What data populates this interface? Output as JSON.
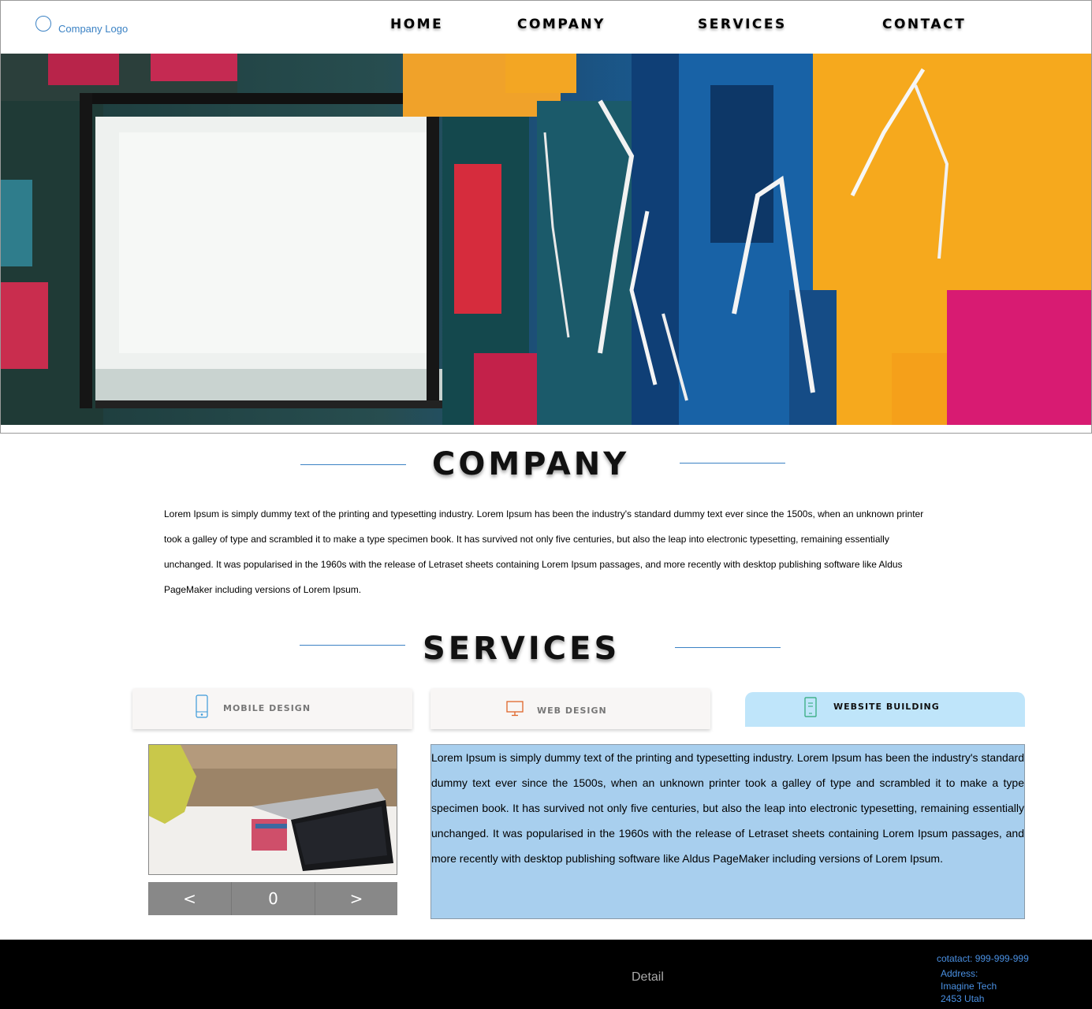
{
  "header": {
    "logo_text": "Company Logo",
    "nav": [
      "HOME",
      "COMPANY",
      "SERVICES",
      "CONTACT"
    ]
  },
  "hero": {
    "icon": "abstract-painting-image"
  },
  "company": {
    "title": "COMPANY",
    "body": "Lorem Ipsum is simply dummy text of the printing and typesetting industry. Lorem Ipsum has been the industry's standard dummy text ever since the 1500s, when an unknown printer took a galley of type and scrambled it to make a type specimen book. It has survived not only five centuries, but also the leap into electronic typesetting, remaining essentially unchanged. It was popularised in the 1960s with the release of Letraset sheets containing Lorem Ipsum passages, and more recently with desktop publishing software like Aldus PageMaker including versions of Lorem Ipsum."
  },
  "services": {
    "title": "SERVICES",
    "tabs": [
      {
        "label": "MOBILE DESIGN",
        "icon": "mobile-phone-icon",
        "icon_color": "#3b9ad9"
      },
      {
        "label": "WEB DESIGN",
        "icon": "monitor-icon",
        "icon_color": "#e0662a"
      },
      {
        "label": "WEBSITE BUILDING",
        "icon": "tablet-icon",
        "icon_color": "#2aa876",
        "active": true
      }
    ],
    "slider": {
      "prev": "<",
      "index": "0",
      "next": ">"
    },
    "body": "Lorem Ipsum is simply dummy text of the printing and typesetting industry. Lorem Ipsum has been the industry's standard dummy text ever since the 1500s, when an unknown printer took a galley of type and scrambled it to make a type specimen book. It has survived not only five centuries, but also the leap into electronic typesetting, remaining essentially unchanged. It was popularised in the 1960s with the release of Letraset sheets containing Lorem Ipsum passages, and more recently with desktop publishing software like Aldus PageMaker including versions of Lorem Ipsum."
  },
  "footer": {
    "detail": "Detail",
    "contact": "cotatact: 999-999-999",
    "address_label": "Address:",
    "address_line1": "Imagine Tech",
    "address_line2": "2453 Utah"
  },
  "colors": {
    "accent": "#3b82c4",
    "active_tab": "#bfe5fa",
    "text_panel": "#a8cfee",
    "footer_bg": "#000000"
  }
}
